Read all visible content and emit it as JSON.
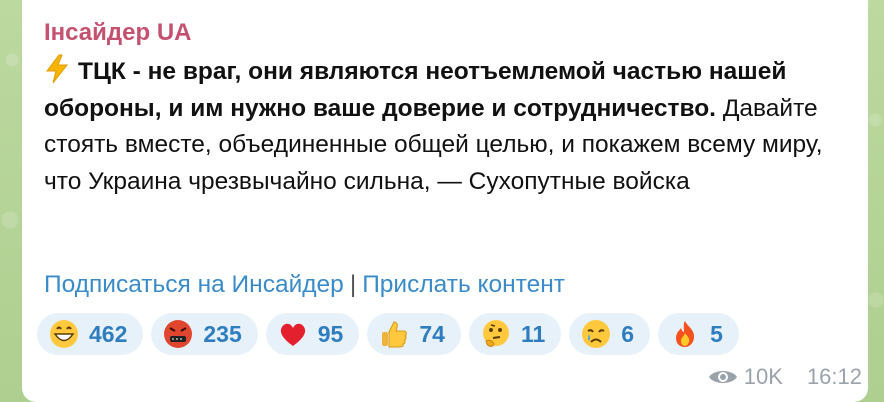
{
  "channel": {
    "name": "Інсайдер UA"
  },
  "message": {
    "bolt_icon": "lightning-emoji",
    "bold_text": "ТЦК - не враг, они являются неотъемлемой частью нашей обороны, и им нужно ваше доверие и сотрудничество.",
    "body_text": "Давайте стоять вместе, объединенные общей целью, и покажем всему миру, что Украина чрезвычайно сильна, — Сухопутные войска"
  },
  "links": {
    "subscribe": "Подписаться на Инсайдер",
    "separator": "|",
    "send": "Прислать контент"
  },
  "reactions": [
    {
      "emoji": "grinning-face-emoji",
      "count": "462"
    },
    {
      "emoji": "cursing-face-emoji",
      "count": "235"
    },
    {
      "emoji": "red-heart-emoji",
      "count": "95"
    },
    {
      "emoji": "thumbs-up-emoji",
      "count": "74"
    },
    {
      "emoji": "thinking-face-emoji",
      "count": "11"
    },
    {
      "emoji": "crying-face-emoji",
      "count": "6"
    },
    {
      "emoji": "fire-emoji",
      "count": "5"
    }
  ],
  "meta": {
    "views": "10K",
    "time": "16:12"
  },
  "colors": {
    "channel_name": "#c4516f",
    "link": "#3a8bc9",
    "reaction_bg": "#e7f1fa",
    "reaction_count": "#2f7dbe",
    "meta": "#9aa3ab"
  }
}
